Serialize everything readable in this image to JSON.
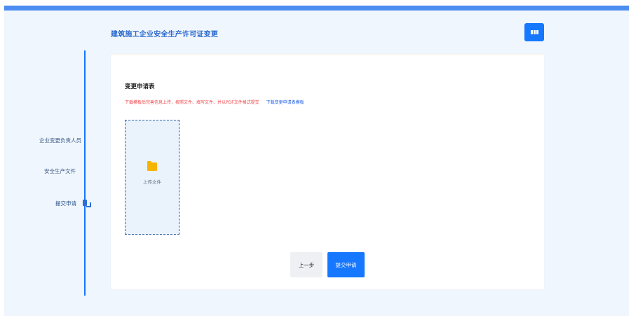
{
  "header": {
    "title": "建筑施工企业安全生产许可证变更",
    "menu_icon": "grid-icon"
  },
  "steps": [
    {
      "label": "企业变更负责人员"
    },
    {
      "label": "安全生产文件"
    },
    {
      "label": "提交申请"
    }
  ],
  "form": {
    "title": "变更申请表",
    "notice": "下载模板后完善信息上传，按照文件、填写文件、并以PDF文件格式提交",
    "template_link": "下载变更申请表模板",
    "upload_label": "上传文件"
  },
  "actions": {
    "prev_label": "上一步",
    "submit_label": "提交申请"
  },
  "colors": {
    "accent": "#1677ff",
    "notice_red": "#f0454a",
    "folder": "#f5b400",
    "background": "#f0f6fd"
  }
}
